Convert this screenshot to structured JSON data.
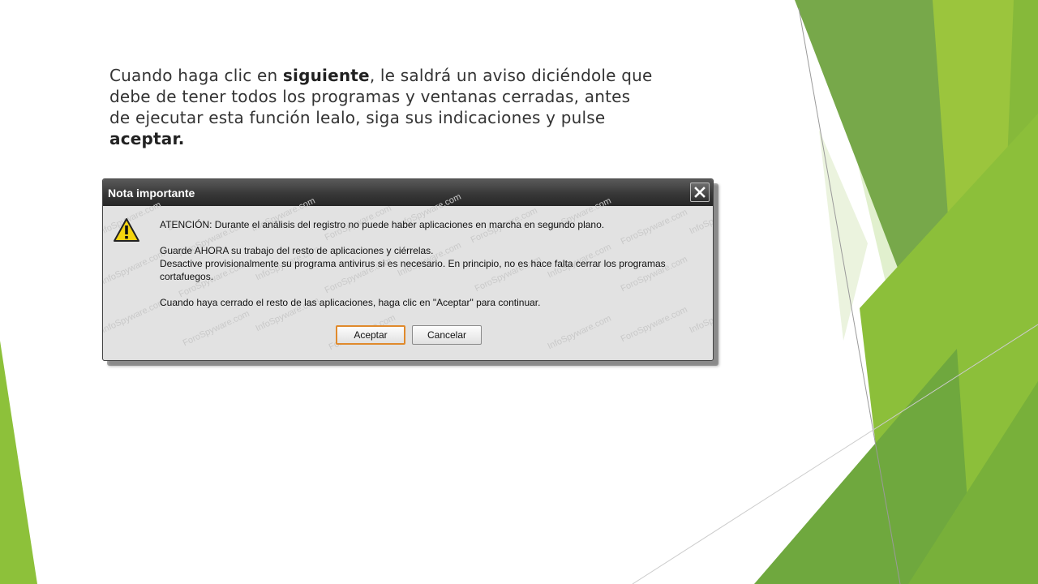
{
  "slide": {
    "intro": {
      "p1": "Cuando haga clic en ",
      "bold1": "siguiente",
      "p2": ", le saldrá un aviso diciéndole que debe de tener todos los programas y ventanas cerradas, antes de ejecutar esta función lealo, siga sus indicaciones y pulse ",
      "bold2": "aceptar."
    }
  },
  "dialog": {
    "title": "Nota importante",
    "close_icon": "close-icon",
    "warning_icon": "warning-icon",
    "line1": "ATENCIÓN: Durante el análisis del registro no puede haber aplicaciones en marcha en segundo plano.",
    "line2": "Guarde AHORA su trabajo del resto de aplicaciones y ciérrelas.",
    "line3": "Desactive provisionalmente su programa antivirus si es necesario. En principio, no es hace falta cerrar los programas",
    "line4": "cortafuegos.",
    "line5": "Cuando haya cerrado el resto de las aplicaciones, haga clic en \"Aceptar\" para continuar.",
    "accept_label": "Aceptar",
    "cancel_label": "Cancelar",
    "watermarks": [
      "InfoSpyware.com",
      "&",
      "ForoSpyware.com"
    ]
  },
  "colors": {
    "green_dark": "#6aa84f",
    "green_light": "#9bc53d",
    "accent_orange": "#e08a2c"
  }
}
